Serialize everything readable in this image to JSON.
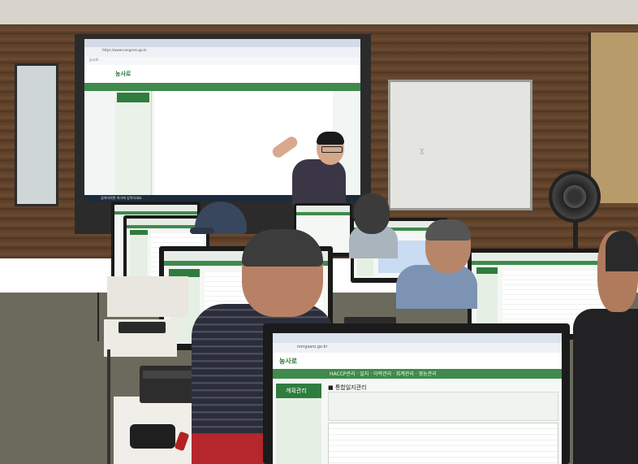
{
  "scene": {
    "description_kind": "photo",
    "colors": {
      "wall": "#5a3e28",
      "projection_bg": "#f1f5f3",
      "app_green": "#3f8a4c",
      "shirt_red": "#b5262d"
    }
  },
  "projection": {
    "url_text": "https://www.nongsaro.go.kr",
    "bookmarks_text": "농사로 ·",
    "logo_text": "농사로",
    "taskbar_search": "검색하려면 여기에 입력하세요."
  },
  "big_monitor": {
    "url_text": "nongsaro.go.kr",
    "logo_text": "농사로",
    "nav_text": "HACCP관리 · 일지 · 이력관리 · 회계관리 · 영농관리",
    "sidebar_title": "계획관리",
    "page_title": "■ 통합일지관리"
  },
  "whiteboard": {
    "note": "ɣ"
  }
}
